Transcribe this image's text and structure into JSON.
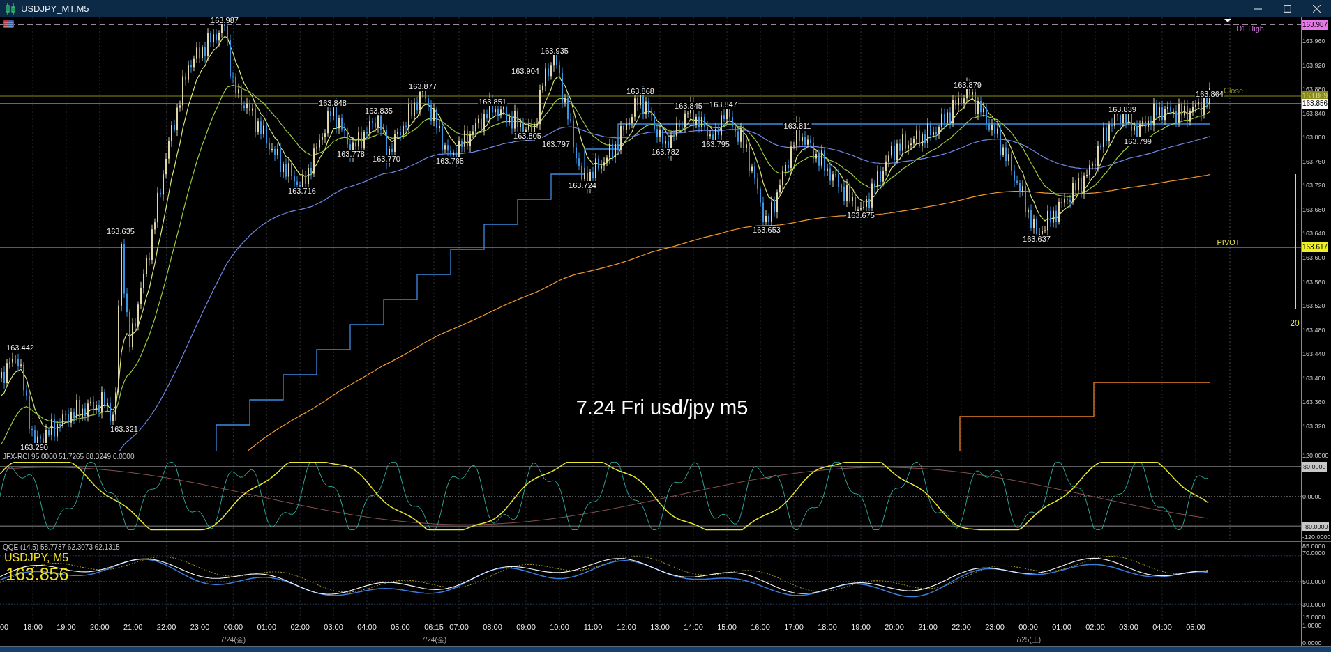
{
  "window": {
    "title": "USDJPY_MT,M5"
  },
  "price_chart": {
    "price_axis": [
      "163.960",
      "163.920",
      "163.880",
      "163.840",
      "163.800",
      "163.760",
      "163.720",
      "163.680",
      "163.640",
      "163.600",
      "163.560",
      "163.520",
      "163.480",
      "163.440",
      "163.400",
      "163.360",
      "163.320"
    ],
    "price_tags": [
      {
        "kind": "high",
        "text": "163.987"
      },
      {
        "kind": "close",
        "text": "163.869"
      },
      {
        "kind": "bid",
        "text": "163.856"
      },
      {
        "kind": "pivot",
        "text": "163.617"
      }
    ],
    "line_labels": [
      {
        "kind": "high",
        "text": "D1 High"
      },
      {
        "kind": "close",
        "text": "Close"
      },
      {
        "kind": "pivot",
        "text": "PIVOT"
      },
      {
        "kind": "count",
        "text": "20"
      }
    ],
    "swing_labels": [
      "163.987",
      "163.877",
      "163.848",
      "163.835",
      "163.851",
      "163.904",
      "163.935",
      "163.868",
      "163.845",
      "163.847",
      "163.811",
      "163.879",
      "163.839",
      "163.864",
      "163.778",
      "163.770",
      "163.765",
      "163.805",
      "163.797",
      "163.782",
      "163.795",
      "163.716",
      "163.724",
      "163.653",
      "163.675",
      "163.637",
      "163.799",
      "163.635",
      "163.442",
      "163.321",
      "163.290"
    ],
    "caption": "7.24 Fri usd/jpy m5"
  },
  "rci_pane": {
    "legend": "JFX-RCI 95.0000 51.7265 88.3249 0.0000",
    "axis": [
      {
        "text": "120.0000",
        "boxed": false
      },
      {
        "text": "80.0000",
        "boxed": true
      },
      {
        "text": "0.0000",
        "boxed": false
      },
      {
        "text": "-80.0000",
        "boxed": true
      },
      {
        "text": "-120.0000",
        "boxed": false
      }
    ]
  },
  "qqe_pane": {
    "legend": "QQE (14,5) 58.7737 62.3073 62.1315",
    "symbol": "USDJPY, M5",
    "price": "163.856",
    "axis": [
      "85.0000",
      "70.0000",
      "50.0000",
      "30.0000",
      "15.0000"
    ]
  },
  "time_axis": {
    "times": [
      "00",
      "18:00",
      "19:00",
      "20:00",
      "21:00",
      "22:00",
      "23:00",
      "00:00",
      "01:00",
      "02:00",
      "03:00",
      "04:00",
      "05:00",
      "06:15",
      "07:00",
      "08:00",
      "09:00",
      "10:00",
      "11:00",
      "12:00",
      "13:00",
      "14:00",
      "15:00",
      "16:00",
      "17:00",
      "18:00",
      "19:00",
      "20:00",
      "21:00",
      "22:00",
      "23:00",
      "00:00",
      "01:00",
      "02:00",
      "03:00",
      "04:00",
      "05:00"
    ],
    "dates": [
      "7/24(金)",
      "7/24(金)",
      "7/25(土)"
    ],
    "axis": [
      "1.0000",
      "0.0000"
    ]
  }
}
